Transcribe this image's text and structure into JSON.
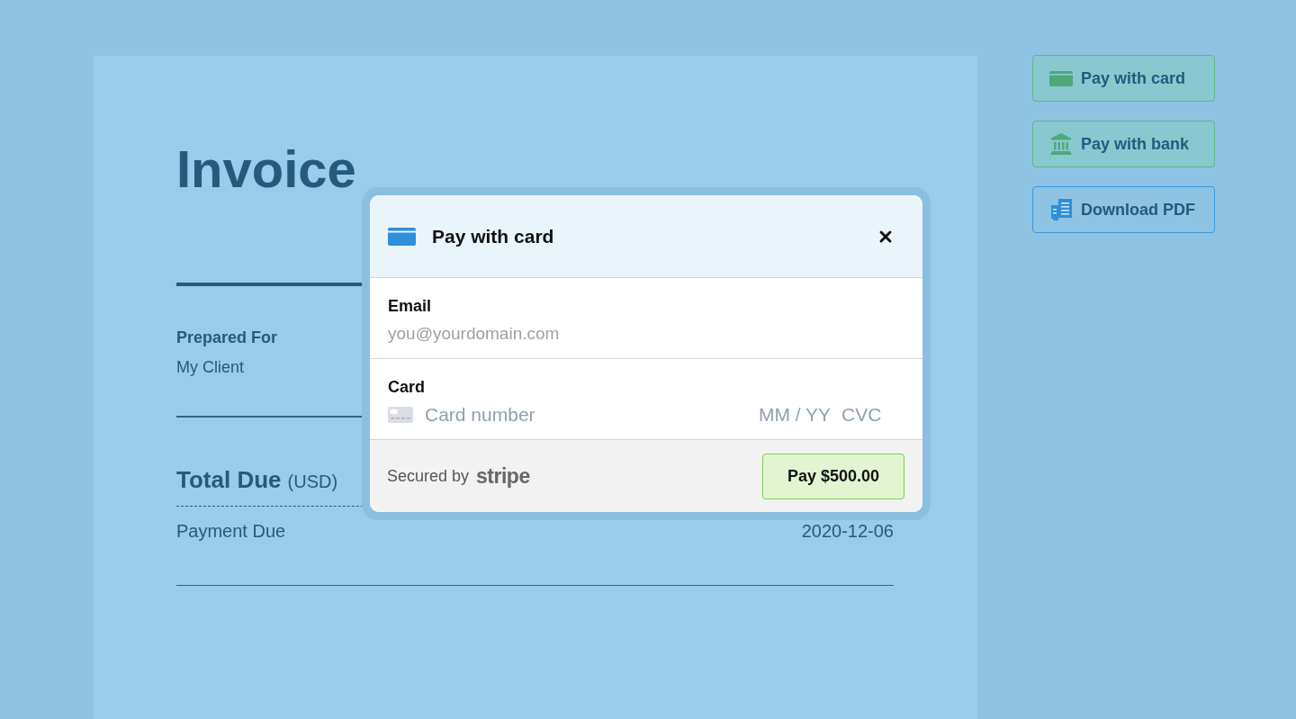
{
  "invoice": {
    "title": "Invoice",
    "prepared_for": {
      "label": "Prepared For",
      "value": "My Client"
    },
    "total_due": {
      "label": "Total Due",
      "currency": "(USD)"
    },
    "payment_due": {
      "label": "Payment Due",
      "value": "2020-12-06"
    }
  },
  "side_actions": [
    {
      "label": "Pay with card",
      "kind": "card"
    },
    {
      "label": "Pay with bank",
      "kind": "bank"
    },
    {
      "label": "Download PDF",
      "kind": "pdf"
    }
  ],
  "modal": {
    "title": "Pay with card",
    "fields": [
      {
        "kind": "email",
        "label": "Email",
        "placeholder": "you@yourdomain.com"
      },
      {
        "kind": "card",
        "label": "Card",
        "placeholder": "Card number",
        "expiry_placeholder": "MM / YY",
        "cvc_placeholder": "CVC"
      }
    ],
    "footer": {
      "secured_by": "Secured by",
      "brand": "stripe",
      "pay_button": "Pay $500.00"
    }
  }
}
